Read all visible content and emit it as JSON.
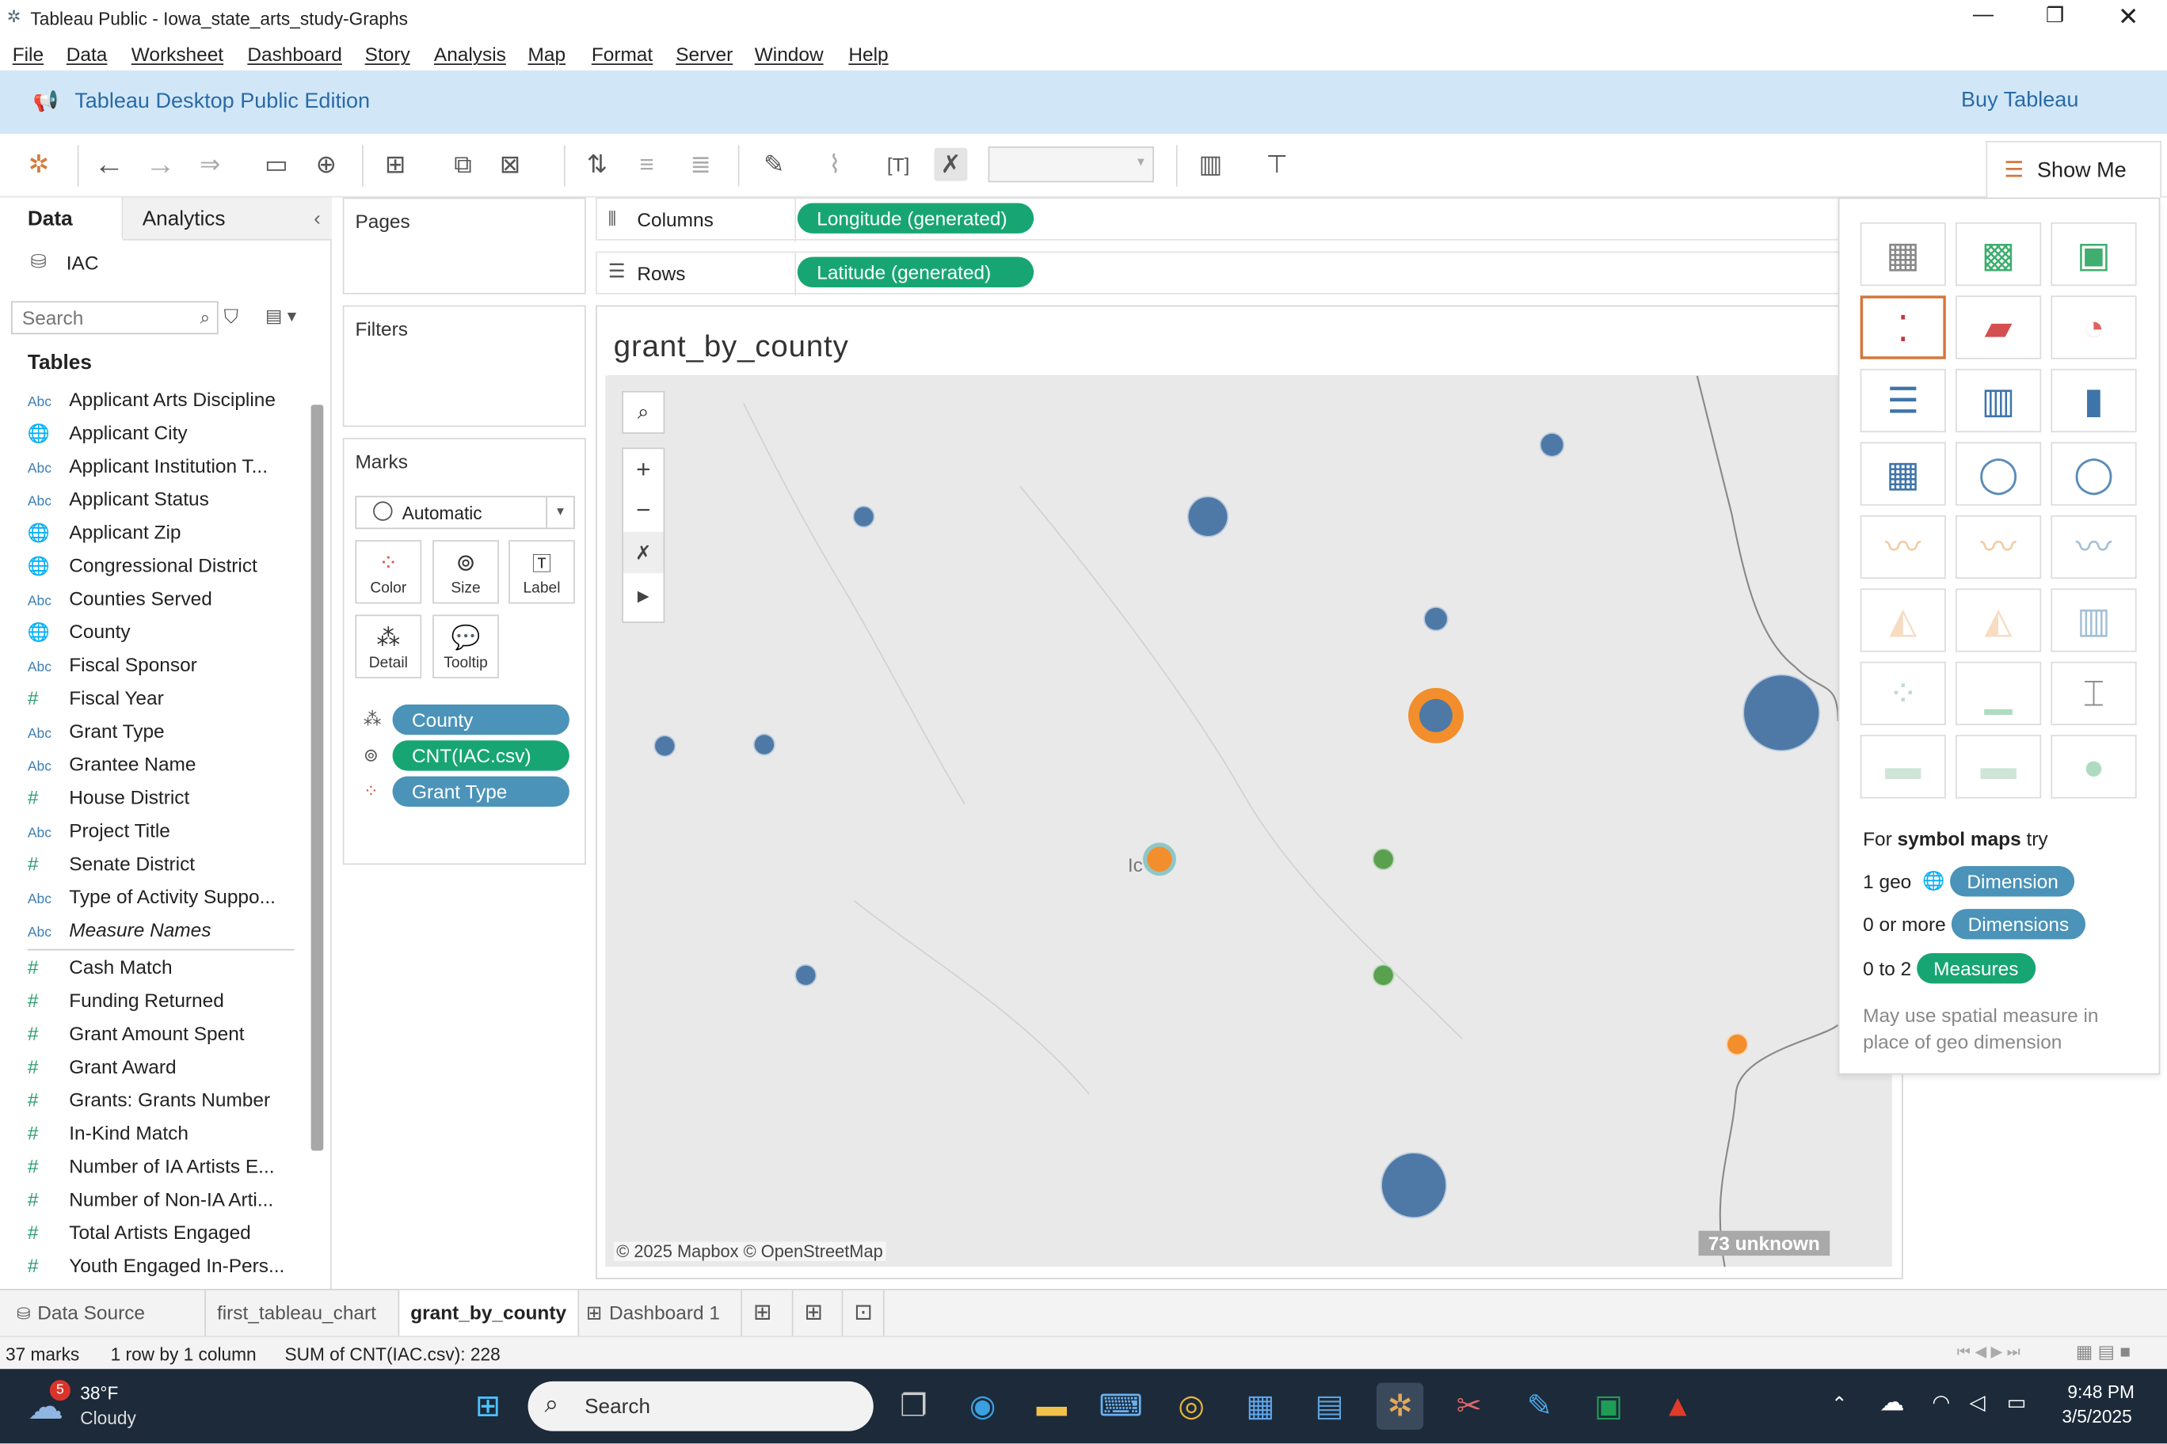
{
  "window": {
    "title": "Tableau Public - Iowa_state_arts_study-Graphs"
  },
  "menu": [
    "File",
    "Data",
    "Worksheet",
    "Dashboard",
    "Story",
    "Analysis",
    "Map",
    "Format",
    "Server",
    "Window",
    "Help"
  ],
  "promo": {
    "edition": "Tableau Desktop Public Edition",
    "buy": "Buy Tableau"
  },
  "toolbar": {
    "show_me": "Show Me"
  },
  "data_pane": {
    "tab_data": "Data",
    "tab_analytics": "Analytics",
    "source": "IAC",
    "search_placeholder": "Search",
    "tables_heading": "Tables",
    "fields": [
      {
        "type": "Abc",
        "name": "Applicant Arts Discipline"
      },
      {
        "type": "geo",
        "name": "Applicant City"
      },
      {
        "type": "Abc",
        "name": "Applicant Institution T..."
      },
      {
        "type": "Abc",
        "name": "Applicant Status"
      },
      {
        "type": "geo",
        "name": "Applicant Zip"
      },
      {
        "type": "geo",
        "name": "Congressional District"
      },
      {
        "type": "Abc",
        "name": "Counties Served"
      },
      {
        "type": "geo",
        "name": "County"
      },
      {
        "type": "Abc",
        "name": "Fiscal Sponsor"
      },
      {
        "type": "#",
        "name": "Fiscal Year"
      },
      {
        "type": "Abc",
        "name": "Grant Type"
      },
      {
        "type": "Abc",
        "name": "Grantee Name"
      },
      {
        "type": "#",
        "name": "House District"
      },
      {
        "type": "Abc",
        "name": "Project Title"
      },
      {
        "type": "#",
        "name": "Senate District"
      },
      {
        "type": "Abc",
        "name": "Type of Activity Suppo..."
      },
      {
        "type": "Abc",
        "name": "Measure Names"
      }
    ],
    "measures": [
      "Cash Match",
      "Funding Returned",
      "Grant Amount Spent",
      "Grant Award",
      "Grants: Grants Number",
      "In-Kind Match",
      "Number of IA Artists E...",
      "Number of Non-IA Arti...",
      "Total Artists Engaged",
      "Youth Engaged In-Pers..."
    ]
  },
  "cards": {
    "pages": "Pages",
    "filters": "Filters",
    "marks": "Marks",
    "mark_type": "Automatic",
    "buttons": [
      "Color",
      "Size",
      "Label",
      "Detail",
      "Tooltip"
    ],
    "pills": [
      "County",
      "CNT(IAC.csv)",
      "Grant Type"
    ]
  },
  "shelves": {
    "columns_label": "Columns",
    "rows_label": "Rows",
    "columns_pill": "Longitude (generated)",
    "rows_pill": "Latitude (generated)"
  },
  "view": {
    "title": "grant_by_county",
    "attribution": "© 2025 Mapbox © OpenStreetMap",
    "unknown": "73 unknown",
    "city_label": "Ic"
  },
  "colors": {
    "blue": "#4e79a7",
    "orange": "#f28e2b",
    "green": "#59a14f",
    "pill_green": "#17a673",
    "pill_blue": "#4b93b8"
  },
  "show_me": {
    "hint_prefix": "For",
    "hint_bold": "symbol maps",
    "hint_suffix": "try",
    "req1_label": "1 geo",
    "req1_pill": "Dimension",
    "req2_label": "0 or more",
    "req2_pill": "Dimensions",
    "req3_label": "0 to 2",
    "req3_pill": "Measures",
    "note": "May use spatial measure in place of geo dimension"
  },
  "sheet_tabs": [
    "Data Source",
    "first_tableau_chart",
    "grant_by_county",
    "Dashboard 1"
  ],
  "status": {
    "marks": "37 marks",
    "layout": "1 row by 1 column",
    "sum": "SUM of CNT(IAC.csv): 228"
  },
  "taskbar": {
    "badge": "5",
    "temp": "38°F",
    "weather": "Cloudy",
    "search": "Search",
    "time": "9:48 PM",
    "date": "3/5/2025"
  }
}
